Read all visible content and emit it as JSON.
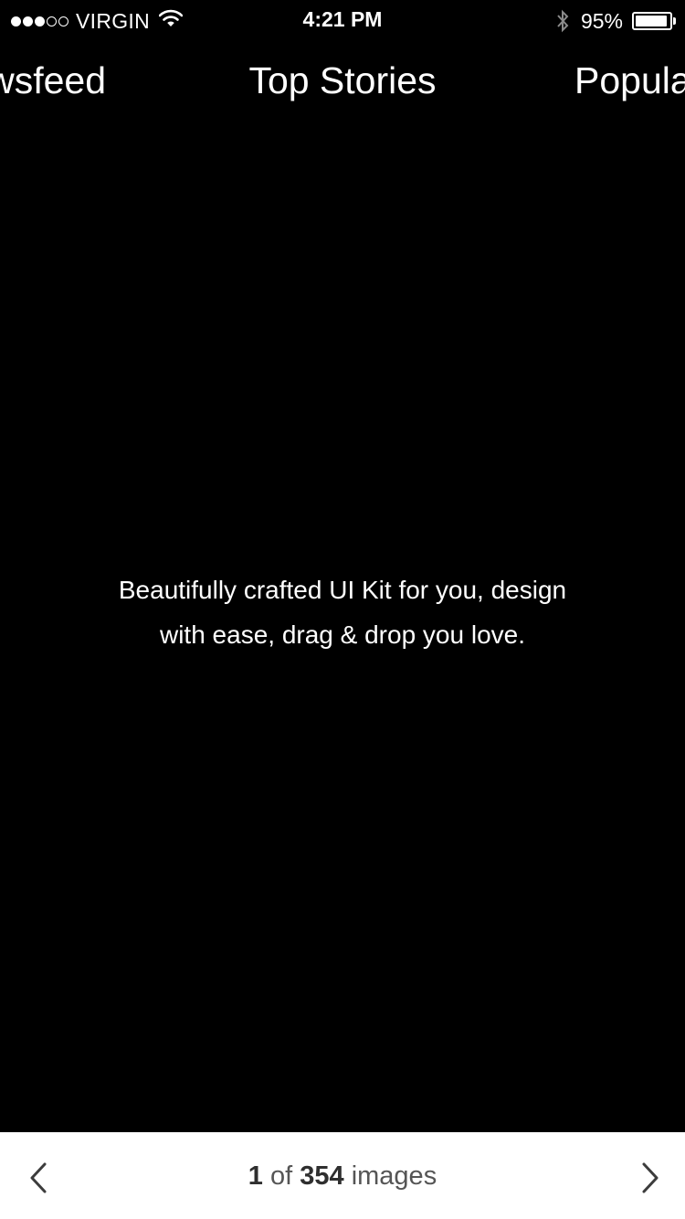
{
  "status_bar": {
    "signal_dots_filled": 3,
    "signal_dots_total": 5,
    "carrier": "VIRGIN",
    "time": "4:21 PM",
    "battery_percent_label": "95%",
    "battery_level": 0.95,
    "icons": [
      "signal-dots",
      "wifi-icon",
      "bluetooth-icon",
      "battery-icon"
    ]
  },
  "tabs": {
    "left": "Newsfeed",
    "center": "Top Stories",
    "right": "Popular"
  },
  "caption": {
    "line1": "Beautifully crafted UI Kit for you, design",
    "line2": "with ease, drag & drop you love."
  },
  "toolbar": {
    "current": "1",
    "of_label": "of",
    "total": "354",
    "unit_label": "images",
    "prev_icon": "chevron-left-icon",
    "next_icon": "chevron-right-icon"
  },
  "colors": {
    "background": "#000000",
    "text": "#ffffff",
    "toolbar_background": "#ffffff",
    "toolbar_text": "#3c3c3c"
  }
}
